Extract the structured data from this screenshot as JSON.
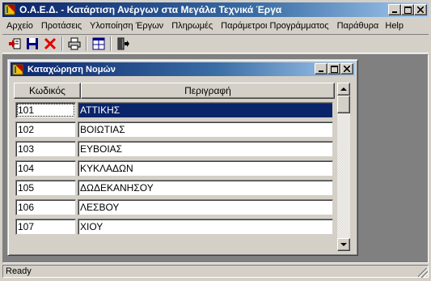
{
  "window": {
    "title": "Ο.Α.Ε.Δ. - Κατάρτιση Ανέργων στα Μεγάλα Τεχνικά Έργα",
    "controls": {
      "minimize": "_",
      "maximize": "□",
      "close": "×"
    }
  },
  "menu": {
    "items": [
      "Αρχείο",
      "Προτάσεις",
      "Υλοποίηση Έργων",
      "Πληρωμές",
      "Παράμετροι Προγράμματος",
      "Παράθυρα"
    ],
    "help": "Help"
  },
  "toolbar": {
    "buttons": [
      "import-icon",
      "save-icon",
      "delete-icon",
      "print-icon",
      "window-icon",
      "exit-icon"
    ],
    "colors": {
      "delete": "#e00000",
      "save": "#000080"
    }
  },
  "child_window": {
    "title": "Καταχώρηση Νομών",
    "controls": {
      "minimize": "_",
      "maximize": "□",
      "close": "×"
    },
    "columns": {
      "code": "Κωδικός",
      "description": "Περιγραφή"
    },
    "rows": [
      {
        "code": "101",
        "description": "ΑΤΤΙΚΗΣ",
        "selected": true
      },
      {
        "code": "102",
        "description": "ΒΟΙΩΤΙΑΣ"
      },
      {
        "code": "103",
        "description": "ΕΥΒΟΙΑΣ"
      },
      {
        "code": "104",
        "description": "ΚΥΚΛΑΔΩΝ"
      },
      {
        "code": "105",
        "description": "ΔΩΔΕΚΑΝΗΣΟΥ"
      },
      {
        "code": "106",
        "description": "ΛΕΣΒΟΥ"
      },
      {
        "code": "107",
        "description": "ΧΙΟΥ"
      }
    ]
  },
  "statusbar": {
    "text": "Ready"
  },
  "colors": {
    "titlebar_start": "#0a246a",
    "titlebar_end": "#a6caf0",
    "selection": "#0a246a",
    "face": "#d4d0c8",
    "mdi_background": "#808080"
  }
}
